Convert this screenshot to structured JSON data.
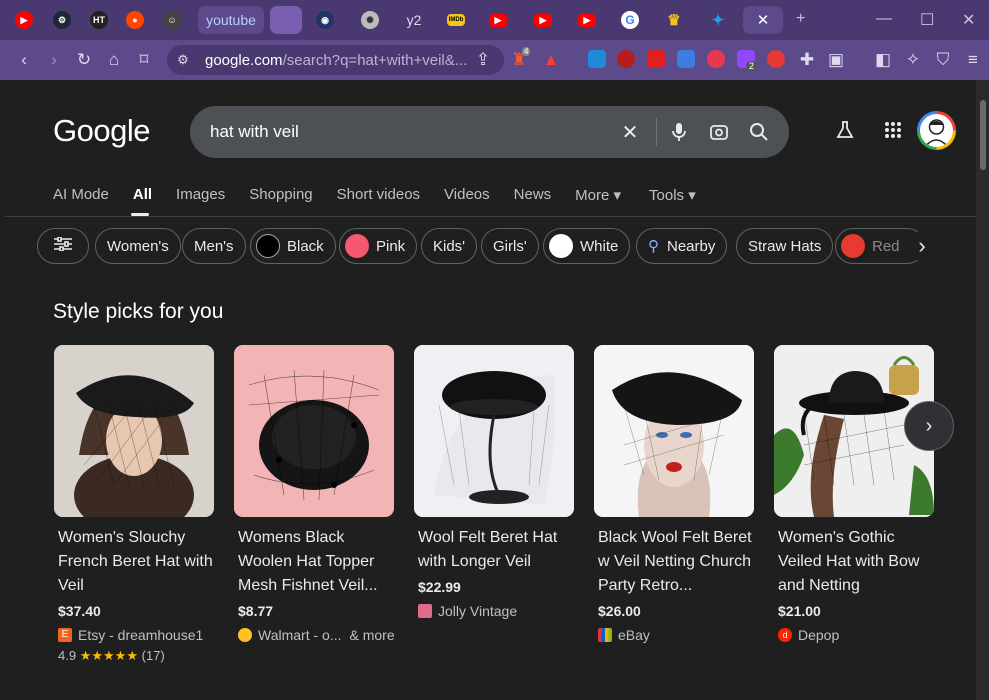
{
  "browser": {
    "tabs": [
      {
        "icon": "youtube-icon",
        "label": "",
        "color": "#ff0000"
      },
      {
        "icon": "steam-icon",
        "label": "",
        "color": "#1b2838"
      },
      {
        "icon": "ht-icon",
        "label": "",
        "color": "#222222"
      },
      {
        "icon": "reddit-icon",
        "label": "",
        "color": "#ff4500"
      },
      {
        "icon": "profile-icon",
        "label": "",
        "color": "#333333"
      },
      {
        "icon": "",
        "label": "youtube",
        "color": ""
      },
      {
        "icon": "blank-tab-icon",
        "label": "",
        "color": "#7a5fb0"
      },
      {
        "icon": "sonic-icon",
        "label": "",
        "color": "#223366"
      },
      {
        "icon": "seal-icon",
        "label": "",
        "color": "#cccccc"
      },
      {
        "icon": "",
        "label": "y2",
        "color": ""
      },
      {
        "icon": "imdb-icon",
        "label": "",
        "color": "#f5c518"
      },
      {
        "icon": "youtube-icon",
        "label": "",
        "color": "#ff0000"
      },
      {
        "icon": "youtube-icon",
        "label": "",
        "color": "#ff0000"
      },
      {
        "icon": "youtube-icon",
        "label": "",
        "color": "#ff0000"
      },
      {
        "icon": "google-icon",
        "label": "",
        "color": "#ffffff"
      },
      {
        "icon": "crown-icon",
        "label": "",
        "color": "#f5c518"
      },
      {
        "icon": "twitter-icon",
        "label": "",
        "color": "#1da1f2"
      }
    ],
    "address": {
      "host": "google.com",
      "path": "/search?q=hat+with+veil&..."
    },
    "brave_badge": "4",
    "ext_badge": "2"
  },
  "google": {
    "logo": "Google",
    "query": "hat with veil",
    "nav": [
      "AI Mode",
      "All",
      "Images",
      "Shopping",
      "Short videos",
      "Videos",
      "News",
      "More ▾",
      "Tools ▾"
    ],
    "chips": [
      {
        "label": "Women's",
        "swatch": ""
      },
      {
        "label": "Men's",
        "swatch": ""
      },
      {
        "label": "Black",
        "swatch": "#000000"
      },
      {
        "label": "Pink",
        "swatch": "#f6586f"
      },
      {
        "label": "Kids'",
        "swatch": ""
      },
      {
        "label": "Girls'",
        "swatch": ""
      },
      {
        "label": "White",
        "swatch": "#ffffff"
      },
      {
        "label": "Nearby",
        "swatch": ""
      },
      {
        "label": "Straw Hats",
        "swatch": ""
      },
      {
        "label": "Red",
        "swatch": "#e53b30"
      }
    ],
    "section_title": "Style picks for you",
    "products": [
      {
        "title": "Women's Slouchy French Beret Hat with Veil",
        "price": "$37.40",
        "seller": "Etsy - dreamhouse1",
        "seller_color": "#f1641e",
        "more": "",
        "rating": "4.9",
        "stars": "★★★★★",
        "reviews": "(17)"
      },
      {
        "title": "Womens Black Woolen Hat Topper Mesh Fishnet Veil...",
        "price": "$8.77",
        "seller": "Walmart - o...",
        "seller_color": "#ffc220",
        "more": "& more",
        "rating": "",
        "stars": "",
        "reviews": ""
      },
      {
        "title": "Wool Felt Beret Hat with Longer Veil",
        "price": "$22.99",
        "seller": "Jolly Vintage",
        "seller_color": "#e06a8a",
        "more": "",
        "rating": "",
        "stars": "",
        "reviews": ""
      },
      {
        "title": "Black Wool Felt Beret w Veil Netting Church Party Retro...",
        "price": "$26.00",
        "seller": "eBay",
        "seller_color": "#0064d2",
        "more": "",
        "rating": "",
        "stars": "",
        "reviews": ""
      },
      {
        "title": "Women's Gothic Veiled Hat with Bow and Netting",
        "price": "$21.00",
        "seller": "Depop",
        "seller_color": "#ff2300",
        "more": "",
        "rating": "",
        "stars": "",
        "reviews": ""
      }
    ]
  }
}
